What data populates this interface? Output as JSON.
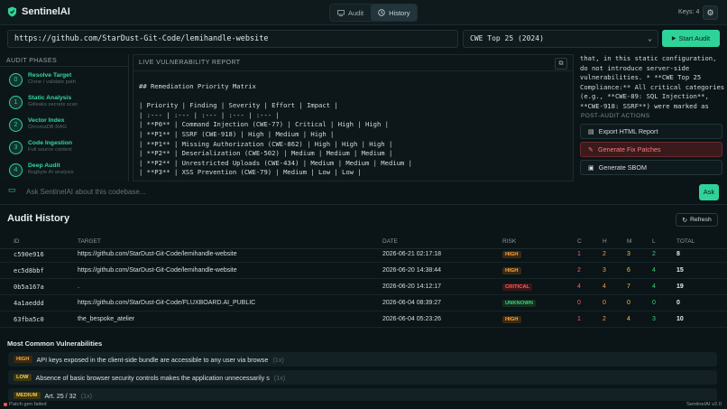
{
  "app": {
    "title": "SentinelAI",
    "keys": "Keys: 4"
  },
  "tabs": [
    {
      "label": "Audit"
    },
    {
      "label": "History"
    }
  ],
  "audit": {
    "url_value": "https://github.com/StarDust-Git-Code/lemihandle-website",
    "standard_selected": "CWE Top 25 (2024)",
    "start_label": "Start Audit"
  },
  "phases": {
    "title": "AUDIT PHASES",
    "items": [
      {
        "num": "0",
        "name": "Resolve Target",
        "sub": "Clone / validate path"
      },
      {
        "num": "1",
        "name": "Static Analysis",
        "sub": "Gitleaks secrets scan"
      },
      {
        "num": "2",
        "name": "Vector Index",
        "sub": "ChromaDB RAG"
      },
      {
        "num": "3",
        "name": "Code Ingestion",
        "sub": "Full source context"
      },
      {
        "num": "4",
        "name": "Deep Audit",
        "sub": "Bugbyte AI analysis"
      }
    ]
  },
  "report": {
    "title": "LIVE VULNERABILITY REPORT",
    "lines": [
      "## Remediation Priority Matrix",
      "",
      "| Priority | Finding | Severity | Effort | Impact |",
      "| :--- | :--- | :--- | :--- | :--- |",
      "| **P0** | Command Injection (CWE-77) | Critical | High | High |",
      "| **P1** | SSRF (CWE-918) | High | Medium | High |",
      "| **P1** | Missing Authorization (CWE-862) | High | High | High |",
      "| **P2** | Deserialization (CWE-502) | Medium | Medium | Medium |",
      "| **P2** | Unrestricted Uploads (CWE-434) | Medium | Medium | Medium |",
      "| **P3** | XSS Prevention (CWE-79) | Medium | Low | Low |"
    ]
  },
  "right_panel": {
    "lines": [
      "that, in this static configuration,",
      "do not introduce server-side",
      "vulnerabilities. * **CWE Top 25",
      "Compliance:** All critical categories",
      "(e.g., **CWE-89: SQL Injection**,",
      "**CWE-918: SSRF**) were marked as"
    ],
    "post_title": "POST-AUDIT ACTIONS",
    "actions": [
      "Export HTML Report",
      "Generate Fix Patches",
      "Generate SBOM"
    ]
  },
  "ask": {
    "placeholder": "Ask SentinelAI about this codebase...",
    "button": "Ask"
  },
  "history": {
    "title": "Audit History",
    "refresh": "Refresh",
    "columns": {
      "id": "ID",
      "target": "TARGET",
      "date": "DATE",
      "risk": "RISK",
      "c": "C",
      "h": "H",
      "m": "M",
      "l": "L",
      "total": "TOTAL"
    },
    "rows": [
      {
        "id": "c590e916",
        "target": "https://github.com/StarDust-Git-Code/lemihandle-website",
        "date": "2026-06-21 02:17:18",
        "risk": "HIGH",
        "c": "1",
        "h": "2",
        "m": "3",
        "l": "2",
        "total": "8"
      },
      {
        "id": "ec5d8bbf",
        "target": "https://github.com/StarDust-Git-Code/lemihandle-website",
        "date": "2026-06-20 14:38:44",
        "risk": "HIGH",
        "c": "2",
        "h": "3",
        "m": "6",
        "l": "4",
        "total": "15"
      },
      {
        "id": "0b5a167a",
        "target": ".",
        "date": "2026-06-20 14:12:17",
        "risk": "CRITICAL",
        "c": "4",
        "h": "4",
        "m": "7",
        "l": "4",
        "total": "19"
      },
      {
        "id": "4a1aeddd",
        "target": "https://github.com/StarDust-Git-Code/FLUXBOARD.AI_PUBLIC",
        "date": "2026-06-04 08:39:27",
        "risk": "UNKNOWN",
        "c": "0",
        "h": "0",
        "m": "0",
        "l": "0",
        "total": "0"
      },
      {
        "id": "63fba5c0",
        "target": "the_bespoke_atelier",
        "date": "2026-06-04 05:23:26",
        "risk": "HIGH",
        "c": "1",
        "h": "2",
        "m": "4",
        "l": "3",
        "total": "10"
      }
    ]
  },
  "vulns": {
    "title": "Most Common Vulnerabilities",
    "items": [
      {
        "severity": "HIGH",
        "text": "API keys exposed in the client-side bundle are accessible to any user via browse",
        "count": "(1x)"
      },
      {
        "severity": "LOW",
        "text": "Absence of basic browser security controls makes the application unnecessarily s",
        "count": "(1x)"
      },
      {
        "severity": "MEDIUM",
        "text": "Art. 25 / 32",
        "count": "(1x)"
      }
    ]
  },
  "status": {
    "message": "Patch gen failed",
    "version": "SentinelAI v2.0"
  },
  "colors": {
    "accent": "#2fd39a",
    "critical": "#ff5a5a",
    "high": "#ffa53a",
    "medium": "#f0c53a",
    "low": "#3bd27a"
  }
}
